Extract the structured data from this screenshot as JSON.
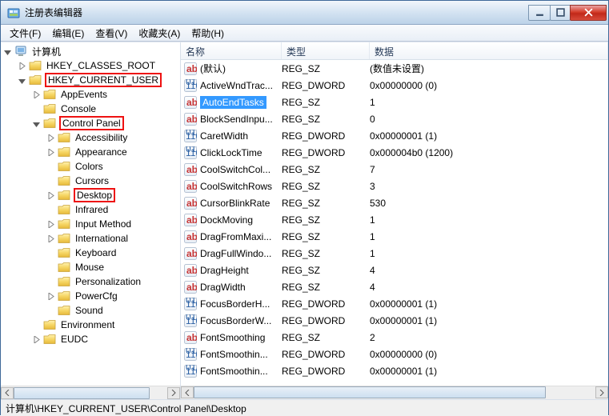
{
  "window": {
    "title": "注册表编辑器"
  },
  "menu": {
    "file": "文件(F)",
    "edit": "编辑(E)",
    "view": "查看(V)",
    "favorites": "收藏夹(A)",
    "help": "帮助(H)"
  },
  "tree": {
    "root": "计算机",
    "hkcr": "HKEY_CLASSES_ROOT",
    "hkcu": "HKEY_CURRENT_USER",
    "appevents": "AppEvents",
    "console": "Console",
    "controlpanel": "Control Panel",
    "accessibility": "Accessibility",
    "appearance": "Appearance",
    "colors": "Colors",
    "cursors": "Cursors",
    "desktop": "Desktop",
    "infrared": "Infrared",
    "inputmethod": "Input Method",
    "international": "International",
    "keyboard": "Keyboard",
    "mouse": "Mouse",
    "personalization": "Personalization",
    "powercfg": "PowerCfg",
    "sound": "Sound",
    "environment": "Environment",
    "eudc": "EUDC"
  },
  "columns": {
    "name": "名称",
    "type": "类型",
    "data": "数据"
  },
  "rows": [
    {
      "icon": "str",
      "name": "(默认)",
      "type": "REG_SZ",
      "data": "(数值未设置)"
    },
    {
      "icon": "bin",
      "name": "ActiveWndTrac...",
      "type": "REG_DWORD",
      "data": "0x00000000 (0)"
    },
    {
      "icon": "str",
      "name": "AutoEndTasks",
      "type": "REG_SZ",
      "data": "1",
      "selected": true
    },
    {
      "icon": "str",
      "name": "BlockSendInpu...",
      "type": "REG_SZ",
      "data": "0"
    },
    {
      "icon": "bin",
      "name": "CaretWidth",
      "type": "REG_DWORD",
      "data": "0x00000001 (1)"
    },
    {
      "icon": "bin",
      "name": "ClickLockTime",
      "type": "REG_DWORD",
      "data": "0x000004b0 (1200)"
    },
    {
      "icon": "str",
      "name": "CoolSwitchCol...",
      "type": "REG_SZ",
      "data": "7"
    },
    {
      "icon": "str",
      "name": "CoolSwitchRows",
      "type": "REG_SZ",
      "data": "3"
    },
    {
      "icon": "str",
      "name": "CursorBlinkRate",
      "type": "REG_SZ",
      "data": "530"
    },
    {
      "icon": "str",
      "name": "DockMoving",
      "type": "REG_SZ",
      "data": "1"
    },
    {
      "icon": "str",
      "name": "DragFromMaxi...",
      "type": "REG_SZ",
      "data": "1"
    },
    {
      "icon": "str",
      "name": "DragFullWindo...",
      "type": "REG_SZ",
      "data": "1"
    },
    {
      "icon": "str",
      "name": "DragHeight",
      "type": "REG_SZ",
      "data": "4"
    },
    {
      "icon": "str",
      "name": "DragWidth",
      "type": "REG_SZ",
      "data": "4"
    },
    {
      "icon": "bin",
      "name": "FocusBorderH...",
      "type": "REG_DWORD",
      "data": "0x00000001 (1)"
    },
    {
      "icon": "bin",
      "name": "FocusBorderW...",
      "type": "REG_DWORD",
      "data": "0x00000001 (1)"
    },
    {
      "icon": "str",
      "name": "FontSmoothing",
      "type": "REG_SZ",
      "data": "2"
    },
    {
      "icon": "bin",
      "name": "FontSmoothin...",
      "type": "REG_DWORD",
      "data": "0x00000000 (0)"
    },
    {
      "icon": "bin",
      "name": "FontSmoothin...",
      "type": "REG_DWORD",
      "data": "0x00000001 (1)"
    }
  ],
  "statusbar": "计算机\\HKEY_CURRENT_USER\\Control Panel\\Desktop"
}
